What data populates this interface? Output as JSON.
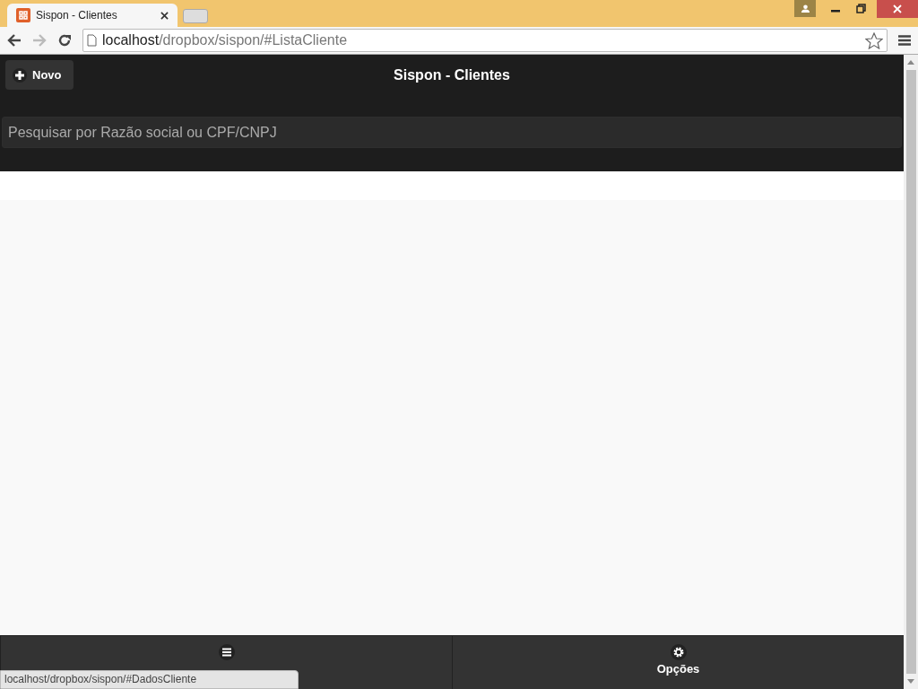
{
  "browser": {
    "tab_title": "Sispon - Clientes",
    "url_host": "localhost",
    "url_path": "/dropbox/sispon/#ListaCliente",
    "status_url": "localhost/dropbox/sispon/#DadosCliente"
  },
  "header": {
    "new_button": "Novo",
    "title": "Sispon - Clientes"
  },
  "search": {
    "placeholder": "Pesquisar por Razão social ou CPF/CNPJ"
  },
  "footer": [
    {
      "kind": "menu"
    },
    {
      "kind": "options",
      "label": "Opções"
    }
  ]
}
